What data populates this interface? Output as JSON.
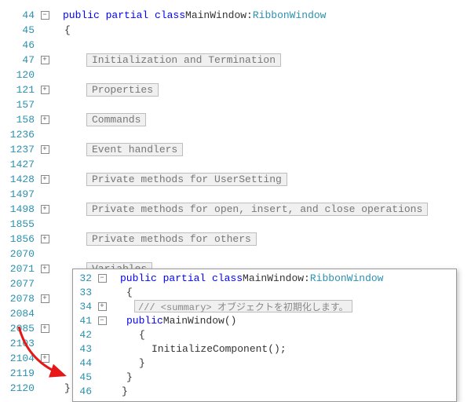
{
  "main": {
    "decl": {
      "kw1": "public",
      "kw2": "partial",
      "kw3": "class",
      "name": "MainWindow",
      "colon": ":",
      "base": "RibbonWindow"
    },
    "open_brace": "{",
    "close_brace": "}",
    "lines": [
      {
        "n": "44",
        "fold": "-",
        "type": "decl"
      },
      {
        "n": "45",
        "fold": "",
        "type": "open"
      },
      {
        "n": "46",
        "fold": "",
        "type": "blank"
      },
      {
        "n": "47",
        "fold": "+",
        "type": "region",
        "label": "Initialization and Termination"
      },
      {
        "n": "120",
        "fold": "",
        "type": "blank"
      },
      {
        "n": "121",
        "fold": "+",
        "type": "region",
        "label": "Properties"
      },
      {
        "n": "157",
        "fold": "",
        "type": "blank"
      },
      {
        "n": "158",
        "fold": "+",
        "type": "region",
        "label": "Commands"
      },
      {
        "n": "1236",
        "fold": "",
        "type": "blank"
      },
      {
        "n": "1237",
        "fold": "+",
        "type": "region",
        "label": "Event handlers"
      },
      {
        "n": "1427",
        "fold": "",
        "type": "blank"
      },
      {
        "n": "1428",
        "fold": "+",
        "type": "region",
        "label": "Private methods for UserSetting"
      },
      {
        "n": "1497",
        "fold": "",
        "type": "blank"
      },
      {
        "n": "1498",
        "fold": "+",
        "type": "region",
        "label": "Private methods for open, insert, and close operations"
      },
      {
        "n": "1855",
        "fold": "",
        "type": "blank"
      },
      {
        "n": "1856",
        "fold": "+",
        "type": "region",
        "label": "Private methods for others"
      },
      {
        "n": "2070",
        "fold": "",
        "type": "blank"
      },
      {
        "n": "2071",
        "fold": "+",
        "type": "region",
        "label": "Variables"
      },
      {
        "n": "2077",
        "fold": "",
        "type": "blank"
      },
      {
        "n": "2078",
        "fold": "+",
        "type": "blank"
      },
      {
        "n": "2084",
        "fold": "",
        "type": "blank"
      },
      {
        "n": "2085",
        "fold": "+",
        "type": "blank"
      },
      {
        "n": "2103",
        "fold": "",
        "type": "blank"
      },
      {
        "n": "2104",
        "fold": "+",
        "type": "blank"
      },
      {
        "n": "2119",
        "fold": "",
        "type": "blank"
      },
      {
        "n": "2120",
        "fold": "",
        "type": "close"
      }
    ]
  },
  "popup": {
    "decl": {
      "kw1": "public",
      "kw2": "partial",
      "kw3": "class",
      "name": "MainWindow",
      "colon": ":",
      "base": "RibbonWindow"
    },
    "open_brace": "{",
    "close_brace": "}",
    "summary": "/// <summary> オブジェクトを初期化します。",
    "ctor_kw": "public",
    "ctor_name": "MainWindow()",
    "body_call": "InitializeComponent();",
    "lines": [
      {
        "n": "32",
        "fold": "-",
        "type": "decl"
      },
      {
        "n": "33",
        "fold": "",
        "type": "open"
      },
      {
        "n": "34",
        "fold": "+",
        "type": "summary"
      },
      {
        "n": "41",
        "fold": "-",
        "type": "ctor"
      },
      {
        "n": "42",
        "fold": "",
        "type": "open2"
      },
      {
        "n": "43",
        "fold": "",
        "type": "body"
      },
      {
        "n": "44",
        "fold": "",
        "type": "close2"
      },
      {
        "n": "45",
        "fold": "",
        "type": "closebrace"
      },
      {
        "n": "46",
        "fold": "",
        "type": "closeouter"
      }
    ]
  }
}
